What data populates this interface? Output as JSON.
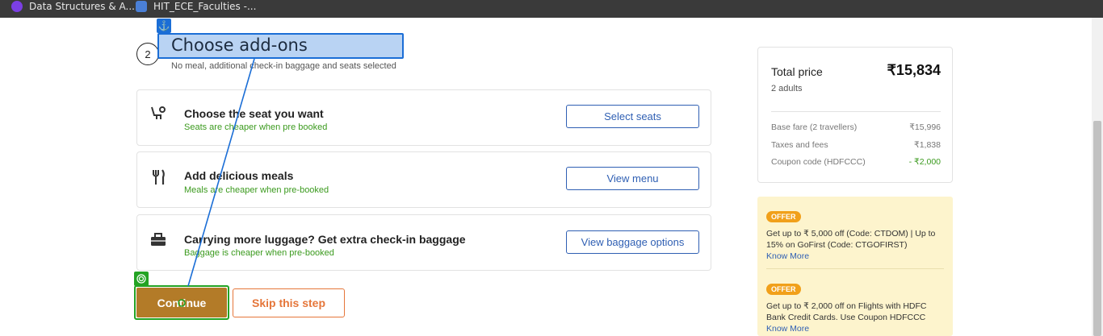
{
  "bookmarks": [
    {
      "label": "Data Structures & A...",
      "icon": "u-purple-icon"
    },
    {
      "label": "HIT_ECE_Faculties -...",
      "icon": "people-icon"
    }
  ],
  "step": {
    "number": "2",
    "title": "Choose add-ons",
    "subtitle": "No meal, additional check-in baggage and seats selected"
  },
  "addons": [
    {
      "title": "Choose the seat you want",
      "subtitle": "Seats are cheaper when pre booked",
      "button": "Select seats",
      "icon": "seat-icon"
    },
    {
      "title": "Add delicious meals",
      "subtitle": "Meals are cheaper when pre-booked",
      "button": "View menu",
      "icon": "cutlery-icon"
    },
    {
      "title": "Carrying more luggage? Get extra check-in baggage",
      "subtitle": "Baggage is cheaper when pre-booked",
      "button": "View baggage options",
      "icon": "suitcase-icon"
    }
  ],
  "actions": {
    "continue": "Continue",
    "skip": "Skip this step"
  },
  "price": {
    "title": "Total price",
    "total": "₹15,834",
    "travellers": "2 adults",
    "rows": [
      {
        "label": "Base fare (2 travellers)",
        "value": "₹15,996"
      },
      {
        "label": "Taxes and fees",
        "value": "₹1,838"
      },
      {
        "label": "Coupon code (HDFCCC)",
        "value": "- ₹2,000"
      }
    ]
  },
  "offers": [
    {
      "badge": "OFFER",
      "text": "Get up to ₹ 5,000 off (Code: CTDOM) | Up to 15% on GoFirst (Code: CTGOFIRST)",
      "link": "Know More"
    },
    {
      "badge": "OFFER",
      "text": "Get up to ₹ 2,000 off on Flights with HDFC Bank Credit Cards. Use Coupon HDFCCC",
      "link": "Know More"
    }
  ],
  "colors": {
    "accent_blue": "#1b6ed6",
    "continue_bg": "#b37b28",
    "skip_orange": "#e5763a",
    "green": "#3b9a1e",
    "offer_bg": "#fdf4cd"
  }
}
